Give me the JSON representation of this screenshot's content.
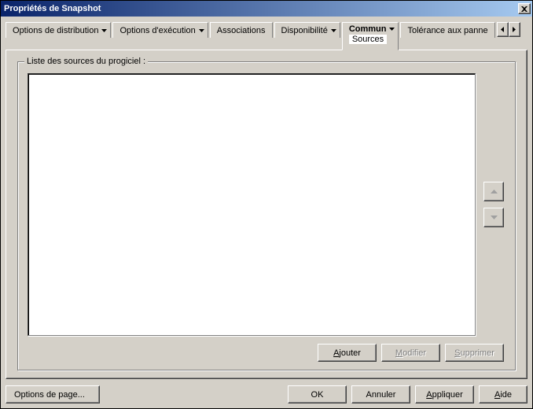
{
  "titlebar": {
    "title": "Propriétés de Snapshot"
  },
  "tabs": {
    "distribution": "Options de distribution",
    "execution": "Options d'exécution",
    "associations": "Associations",
    "availability": "Disponibilité",
    "common": "Commun",
    "common_sub": "Sources",
    "fault": "Tolérance aux panne"
  },
  "group": {
    "legend": "Liste des sources du progiciel :",
    "add": "Ajouter",
    "modify": "Modifier",
    "delete": "Supprimer"
  },
  "bottom": {
    "page_options": "Options de page...",
    "ok": "OK",
    "cancel": "Annuler",
    "apply": "Appliquer",
    "help": "Aide"
  }
}
